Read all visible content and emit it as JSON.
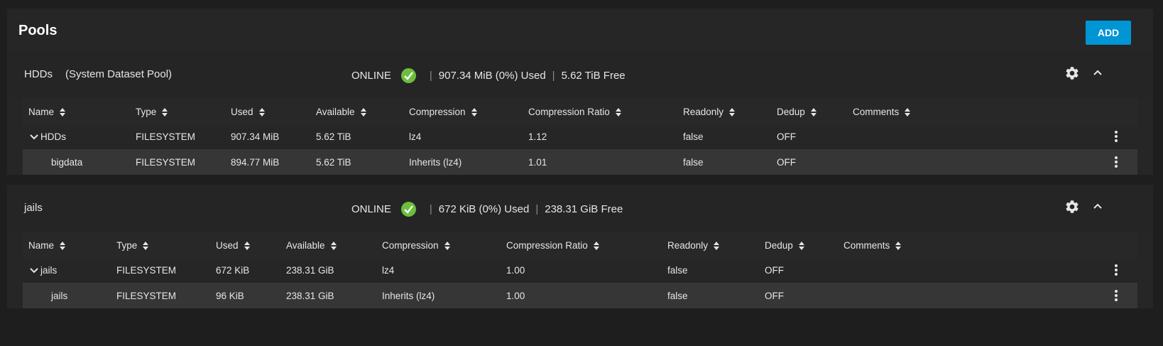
{
  "page": {
    "title": "Pools",
    "add_label": "ADD"
  },
  "columns": [
    "Name",
    "Type",
    "Used",
    "Available",
    "Compression",
    "Compression Ratio",
    "Readonly",
    "Dedup",
    "Comments"
  ],
  "pools": [
    {
      "name": "HDDs",
      "subtitle": "(System Dataset Pool)",
      "status": "ONLINE",
      "used": "907.34 MiB (0%) Used",
      "free": "5.62 TiB Free",
      "rows": [
        {
          "name": "HDDs",
          "type": "FILESYSTEM",
          "used": "907.34 MiB",
          "available": "5.62 TiB",
          "compression": "lz4",
          "ratio": "1.12",
          "readonly": "false",
          "dedup": "OFF",
          "comments": ""
        },
        {
          "name": "bigdata",
          "type": "FILESYSTEM",
          "used": "894.77 MiB",
          "available": "5.62 TiB",
          "compression": "Inherits (lz4)",
          "ratio": "1.01",
          "readonly": "false",
          "dedup": "OFF",
          "comments": ""
        }
      ]
    },
    {
      "name": "jails",
      "subtitle": "",
      "status": "ONLINE",
      "used": "672 KiB (0%) Used",
      "free": "238.31 GiB Free",
      "rows": [
        {
          "name": "jails",
          "type": "FILESYSTEM",
          "used": "672 KiB",
          "available": "238.31 GiB",
          "compression": "lz4",
          "ratio": "1.00",
          "readonly": "false",
          "dedup": "OFF",
          "comments": ""
        },
        {
          "name": "jails",
          "type": "FILESYSTEM",
          "used": "96 KiB",
          "available": "238.31 GiB",
          "compression": "Inherits (lz4)",
          "ratio": "1.00",
          "readonly": "false",
          "dedup": "OFF",
          "comments": ""
        }
      ]
    }
  ],
  "colors": {
    "accent": "#0095d5",
    "online": "#6cbf3e",
    "panel": "#262626",
    "row_alt": "#363636"
  }
}
